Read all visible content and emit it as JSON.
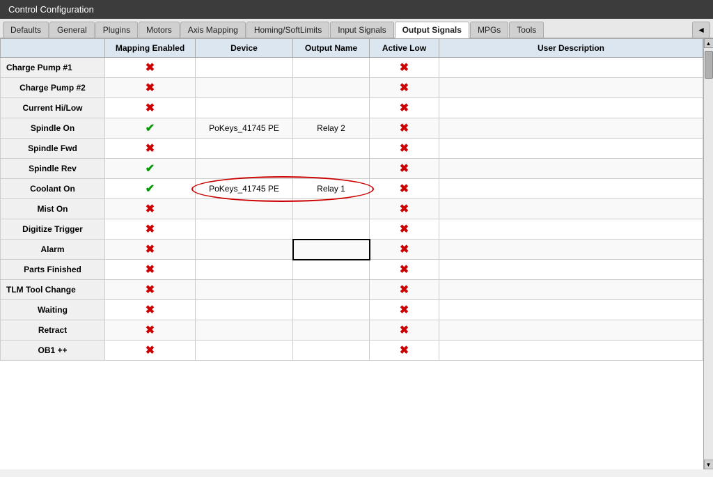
{
  "titleBar": {
    "title": "Control Configuration"
  },
  "tabs": [
    {
      "label": "Defaults",
      "active": false
    },
    {
      "label": "General",
      "active": false
    },
    {
      "label": "Plugins",
      "active": false
    },
    {
      "label": "Motors",
      "active": false
    },
    {
      "label": "Axis Mapping",
      "active": false
    },
    {
      "label": "Homing/SoftLimits",
      "active": false
    },
    {
      "label": "Input Signals",
      "active": false
    },
    {
      "label": "Output Signals",
      "active": true
    },
    {
      "label": "MPGs",
      "active": false
    },
    {
      "label": "Tools",
      "active": false
    }
  ],
  "moreTab": "◄",
  "table": {
    "headers": [
      "",
      "Mapping Enabled",
      "Device",
      "Output Name",
      "Active Low",
      "User Description"
    ],
    "rows": [
      {
        "name": "Charge Pump #1",
        "nameAlign": "left",
        "mapping": "x",
        "device": "",
        "output": "",
        "activeLow": "x",
        "desc": "",
        "highlight": false,
        "activeCell": false
      },
      {
        "name": "Charge Pump #2",
        "nameAlign": "center",
        "mapping": "x",
        "device": "",
        "output": "",
        "activeLow": "x",
        "desc": "",
        "highlight": false,
        "activeCell": false
      },
      {
        "name": "Current Hi/Low",
        "nameAlign": "center",
        "mapping": "x",
        "device": "",
        "output": "",
        "activeLow": "x",
        "desc": "",
        "highlight": false,
        "activeCell": false
      },
      {
        "name": "Spindle On",
        "nameAlign": "center",
        "mapping": "check",
        "device": "PoKeys_41745 PE",
        "output": "Relay 2",
        "activeLow": "x",
        "desc": "",
        "highlight": false,
        "activeCell": false
      },
      {
        "name": "Spindle Fwd",
        "nameAlign": "center",
        "mapping": "x",
        "device": "",
        "output": "",
        "activeLow": "x",
        "desc": "",
        "highlight": false,
        "activeCell": false
      },
      {
        "name": "Spindle Rev",
        "nameAlign": "center",
        "mapping": "check",
        "device": "",
        "output": "",
        "activeLow": "x",
        "desc": "",
        "highlight": false,
        "activeCell": false
      },
      {
        "name": "Coolant On",
        "nameAlign": "center",
        "mapping": "check",
        "device": "PoKeys_41745 PE",
        "output": "Relay 1",
        "activeLow": "x",
        "desc": "",
        "highlight": true,
        "activeCell": false
      },
      {
        "name": "Mist On",
        "nameAlign": "center",
        "mapping": "x",
        "device": "",
        "output": "",
        "activeLow": "x",
        "desc": "",
        "highlight": false,
        "activeCell": false
      },
      {
        "name": "Digitize Trigger",
        "nameAlign": "center",
        "mapping": "x",
        "device": "",
        "output": "",
        "activeLow": "x",
        "desc": "",
        "highlight": false,
        "activeCell": false
      },
      {
        "name": "Alarm",
        "nameAlign": "center",
        "mapping": "x",
        "device": "",
        "output": "",
        "activeLow": "x",
        "desc": "",
        "highlight": false,
        "activeCell": true
      },
      {
        "name": "Parts Finished",
        "nameAlign": "center",
        "mapping": "x",
        "device": "",
        "output": "",
        "activeLow": "x",
        "desc": "",
        "highlight": false,
        "activeCell": false
      },
      {
        "name": "TLM Tool Change",
        "nameAlign": "left",
        "mapping": "x",
        "device": "",
        "output": "",
        "activeLow": "x",
        "desc": "",
        "highlight": false,
        "activeCell": false
      },
      {
        "name": "Waiting",
        "nameAlign": "center",
        "mapping": "x",
        "device": "",
        "output": "",
        "activeLow": "x",
        "desc": "",
        "highlight": false,
        "activeCell": false
      },
      {
        "name": "Retract",
        "nameAlign": "center",
        "mapping": "x",
        "device": "",
        "output": "",
        "activeLow": "x",
        "desc": "",
        "highlight": false,
        "activeCell": false
      },
      {
        "name": "OB1 ++",
        "nameAlign": "center",
        "mapping": "x",
        "device": "",
        "output": "",
        "activeLow": "x",
        "desc": "",
        "highlight": false,
        "activeCell": false
      }
    ]
  },
  "icons": {
    "x": "✖",
    "check": "✔",
    "scrollUp": "▲",
    "scrollDown": "▼",
    "more": "◄"
  }
}
